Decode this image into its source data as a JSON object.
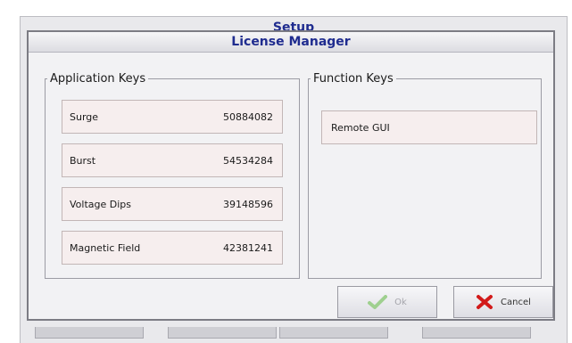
{
  "background_window": {
    "title": "Setup"
  },
  "dialog": {
    "title": "License Manager",
    "application_keys": {
      "legend": "Application Keys",
      "items": [
        {
          "name": "Surge",
          "key": "50884082"
        },
        {
          "name": "Burst",
          "key": "54534284"
        },
        {
          "name": "Voltage Dips",
          "key": "39148596"
        },
        {
          "name": "Magnetic Field",
          "key": "42381241"
        }
      ]
    },
    "function_keys": {
      "legend": "Function Keys",
      "items": [
        {
          "name": "Remote GUI"
        }
      ]
    },
    "buttons": {
      "ok": {
        "label": "Ok",
        "icon": "checkmark-icon",
        "enabled": false
      },
      "cancel": {
        "label": "Cancel",
        "icon": "red-x-icon",
        "enabled": true
      }
    }
  },
  "colors": {
    "title_text": "#1f2c8f",
    "row_background": "#f6eeee",
    "cancel_icon": "#d21a1a",
    "ok_icon_disabled": "#9fd08f"
  }
}
